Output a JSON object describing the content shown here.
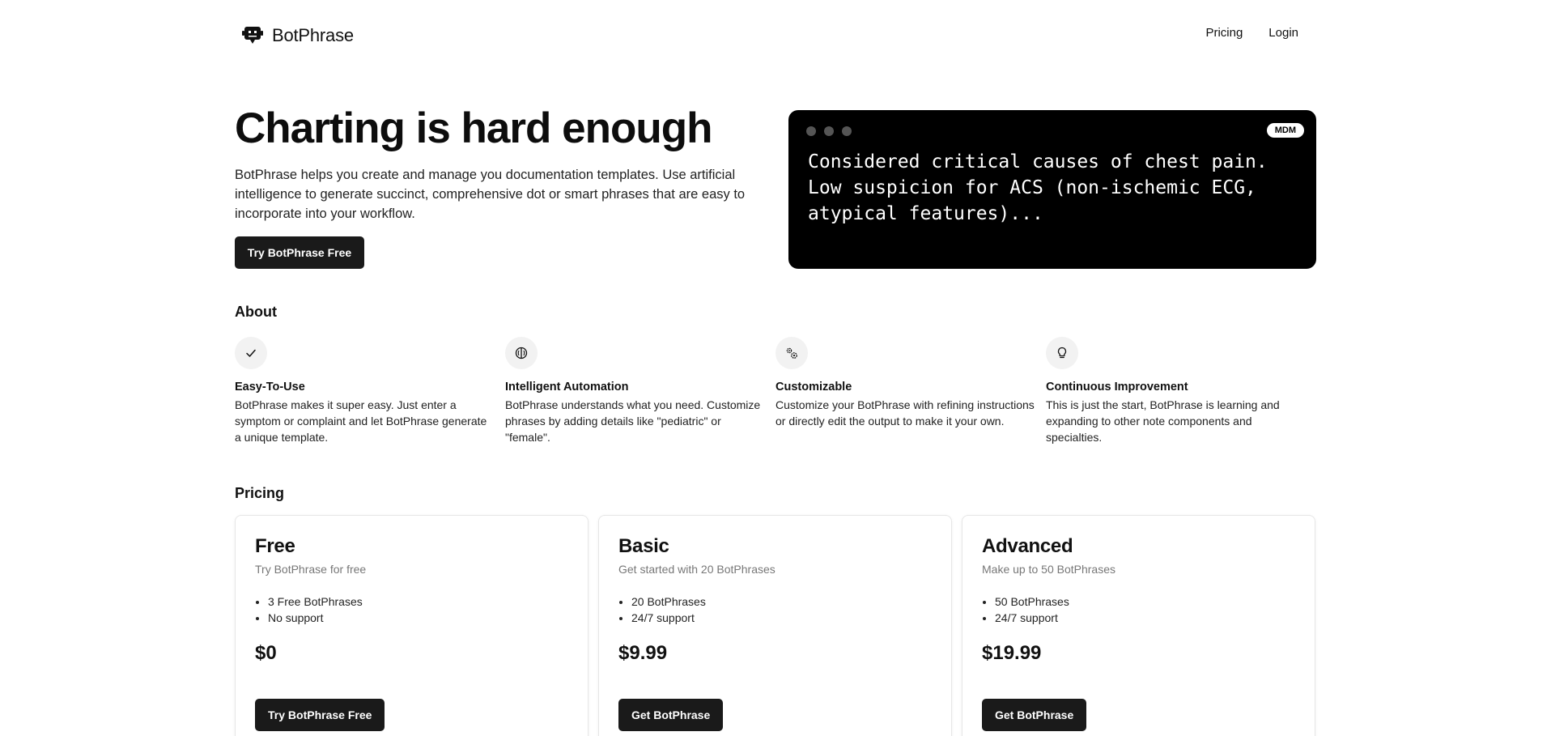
{
  "header": {
    "brand": "BotPhrase",
    "nav": [
      "Pricing",
      "Login"
    ]
  },
  "hero": {
    "title": "Charting is hard enough",
    "description": "BotPhrase helps you create and manage you documentation templates. Use artificial intelligence to generate succinct, comprehensive dot or smart phrases that are easy to incorporate into your workflow.",
    "cta": "Try BotPhrase Free",
    "terminal": {
      "badge": "MDM",
      "text": "Considered critical causes of chest pain. Low suspicion for ACS (non-ischemic ECG, atypical features)..."
    }
  },
  "about": {
    "title": "About",
    "features": [
      {
        "icon": "check-icon",
        "title": "Easy-To-Use",
        "text": "BotPhrase makes it super easy. Just enter a symptom or complaint and let BotPhrase generate a unique template."
      },
      {
        "icon": "brain-icon",
        "title": "Intelligent Automation",
        "text": "BotPhrase understands what you need. Customize phrases by adding details like \"pediatric\" or \"female\"."
      },
      {
        "icon": "gears-icon",
        "title": "Customizable",
        "text": "Customize your BotPhrase with refining instructions or directly edit the output to make it your own."
      },
      {
        "icon": "lightbulb-icon",
        "title": "Continuous Improvement",
        "text": "This is just the start, BotPhrase is learning and expanding to other note components and specialties."
      }
    ]
  },
  "pricing": {
    "title": "Pricing",
    "plans": [
      {
        "name": "Free",
        "subtitle": "Try BotPhrase for free",
        "features": [
          "3 Free BotPhrases",
          "No support"
        ],
        "price": "$0",
        "cta": "Try BotPhrase Free"
      },
      {
        "name": "Basic",
        "subtitle": "Get started with 20 BotPhrases",
        "features": [
          "20 BotPhrases",
          "24/7 support"
        ],
        "price": "$9.99",
        "cta": "Get BotPhrase"
      },
      {
        "name": "Advanced",
        "subtitle": "Make up to 50 BotPhrases",
        "features": [
          "50 BotPhrases",
          "24/7 support"
        ],
        "price": "$19.99",
        "cta": "Get BotPhrase"
      }
    ]
  }
}
